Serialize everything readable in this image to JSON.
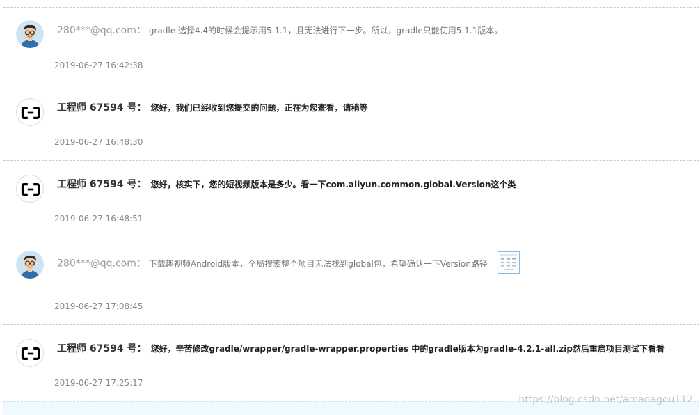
{
  "messages": [
    {
      "role": "user",
      "name": "280***@qq.com：",
      "text": "gradle 选择4.4的时候会提示用5.1.1，且无法进行下一步。所以，gradle只能使用5.1.1版本。",
      "time": "2019-06-27 16:42:38"
    },
    {
      "role": "engineer",
      "name": "工程师 67594 号：",
      "text": "您好，我们已经收到您提交的问题，正在为您查看，请稍等",
      "time": "2019-06-27 16:48:30"
    },
    {
      "role": "engineer",
      "name": "工程师 67594 号：",
      "text": "您好，核实下，您的短视频版本是多少。看一下com.aliyun.common.global.Version这个类",
      "time": "2019-06-27 16:48:51"
    },
    {
      "role": "user",
      "name": "280***@qq.com：",
      "text": "下载趣视频Android版本，全局搜索整个项目无法找到global包，希望确认一下Version路径",
      "time": "2019-06-27 17:08:45",
      "attachment": "image-thumbnail"
    },
    {
      "role": "engineer",
      "name": "工程师 67594 号：",
      "text": "您好，辛苦修改gradle/wrapper/gradle-wrapper.properties 中的gradle版本为gradle-4.2.1-all.zip然后重启项目测试下看看",
      "time": "2019-06-27 17:25:17"
    }
  ],
  "watermark": "https://blog.csdn.net/amaoagou112",
  "colors": {
    "engineer_logo": "#000000",
    "divider": "#c8c8c8",
    "input_strip": "#eefafe"
  }
}
